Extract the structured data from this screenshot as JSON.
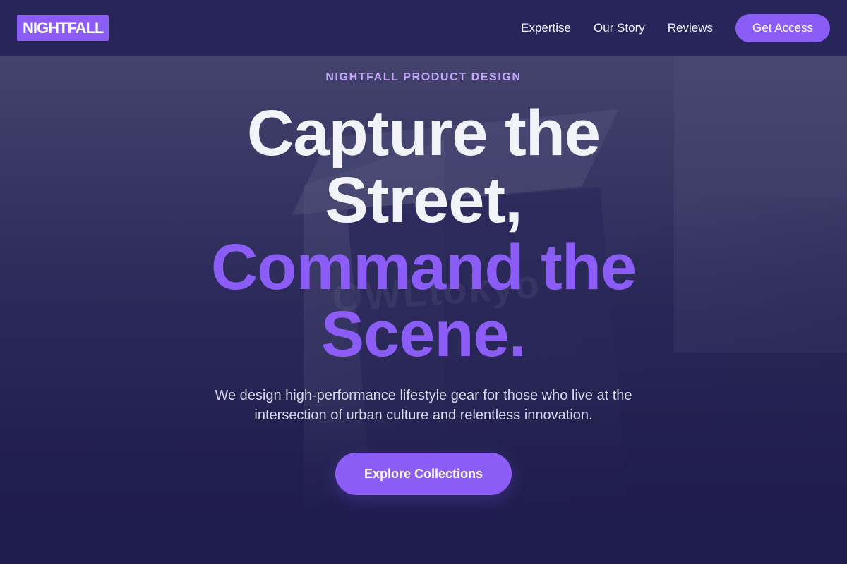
{
  "brand": {
    "logo_text": "NIGHTFALL",
    "accent_color": "#8b5cf6",
    "background_color": "#1f1c4e"
  },
  "nav": {
    "links": [
      {
        "label": "Expertise"
      },
      {
        "label": "Our Story"
      },
      {
        "label": "Reviews"
      }
    ],
    "cta_label": "Get Access"
  },
  "hero": {
    "eyebrow": "NIGHTFALL PRODUCT DESIGN",
    "headline_light": [
      "Capture the",
      "Street,"
    ],
    "headline_accent": [
      "Command the",
      "Scene."
    ],
    "subtitle": "We design high-performance lifestyle gear for those who live at the intersection of urban culture and relentless innovation.",
    "button_label": "Explore Collections"
  },
  "background": {
    "watermark_text": "OWLtokyo"
  }
}
